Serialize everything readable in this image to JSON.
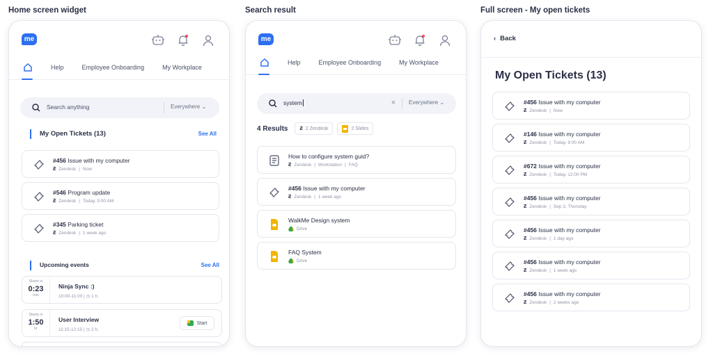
{
  "sections": {
    "widget": "Home screen widget",
    "search": "Search result",
    "full": "Full screen - My open tickets"
  },
  "logo": "me",
  "nav": [
    "Help",
    "Employee Onboarding",
    "My Workplace"
  ],
  "widget": {
    "search_placeholder": "Search anything",
    "scope": "Everywhere",
    "tickets_title": "My Open Tickets (13)",
    "see_all": "See All",
    "tickets": [
      {
        "id": "#456",
        "title": "Issue with my computer",
        "source": "Zendesk",
        "time": "Now"
      },
      {
        "id": "#546",
        "title": "Program update",
        "source": "Zendesk",
        "time": "Today, 9:00 AM"
      },
      {
        "id": "#345",
        "title": "Parking ticket",
        "source": "Zendesk",
        "time": "1 week ago"
      }
    ],
    "events_title": "Upcoming events",
    "events_see_all": "See All",
    "events": [
      {
        "starts": "Starts in",
        "time": "0:23",
        "unit": "min",
        "title": "Ninja Sync :)",
        "range": "10:00-11:00",
        "duration": "1 h."
      },
      {
        "starts": "Starts in",
        "time": "1:50",
        "unit": "hr",
        "title": "User Interview",
        "range": "11:15-12:15",
        "duration": "2 h.",
        "button": "Start"
      }
    ]
  },
  "search": {
    "query": "system",
    "scope": "Everywhere",
    "count": "4 Results",
    "chips": [
      "2 Zendesk",
      "2 Slides"
    ],
    "results": [
      {
        "title": "How to configure system guid?",
        "meta": [
          "Zendesk",
          "Workstation",
          "FAQ"
        ]
      },
      {
        "id": "#456",
        "title": "Issue with my computer",
        "meta": [
          "Zendesk",
          "1 week ago"
        ]
      },
      {
        "title": "WalkMe Design system",
        "meta": [
          "Drive"
        ]
      },
      {
        "title": "FAQ System",
        "meta": [
          "Drive"
        ]
      }
    ]
  },
  "full": {
    "back": "Back",
    "title": "My Open Tickets (13)",
    "tickets": [
      {
        "id": "#456",
        "title": "Issue with my computer",
        "source": "Zendesk",
        "time": "Now"
      },
      {
        "id": "#146",
        "title": "Issue with my computer",
        "source": "Zendesk",
        "time": "Today, 9:00 AM"
      },
      {
        "id": "#672",
        "title": "Issue with my computer",
        "source": "Zendesk",
        "time": "Today, 12:00 PM"
      },
      {
        "id": "#456",
        "title": "Issue with my computer",
        "source": "Zendesk",
        "time": "Sep 3, Thursday"
      },
      {
        "id": "#456",
        "title": "Issue with my computer",
        "source": "Zendesk",
        "time": "1 day ago"
      },
      {
        "id": "#456",
        "title": "Issue with my computer",
        "source": "Zendesk",
        "time": "1 week ago"
      },
      {
        "id": "#456",
        "title": "Issue with my computer",
        "source": "Zendesk",
        "time": "2 weeks ago"
      }
    ]
  }
}
